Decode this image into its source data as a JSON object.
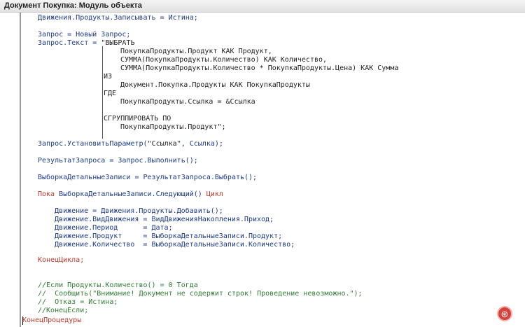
{
  "window": {
    "title": "Документ Покупка: Модуль объекта"
  },
  "code": {
    "l01": "Движения.Продукты.Записывать = Истина;",
    "l02": "Запрос = Новый Запрос;",
    "l03a": "Запрос.Текст = ",
    "l03b": "\"ВЫБРАТЬ",
    "l04": "ПокупкаПродукты.Продукт КАК Продукт,",
    "l05": "СУММА(ПокупкаПродукты.Количество) КАК Количество,",
    "l06": "СУММА(ПокупкаПродукты.Количество * ПокупкаПродукты.Цена) КАК Сумма",
    "l07": "ИЗ",
    "l08": "Документ.Покупка.Продукты КАК ПокупкаПродукты",
    "l09": "ГДЕ",
    "l10": "ПокупкаПродукты.Ссылка = &Ссылка",
    "l11": "СГРУППИРОВАТЬ ПО",
    "l12": "ПокупкаПродукты.Продукт\";",
    "l13a": "Запрос.УстановитьПараметр(",
    "l13b": "\"Ссылка\"",
    "l13c": ", Ссылка);",
    "l14": "РезультатЗапроса = Запрос.Выполнить();",
    "l15": "ВыборкаДетальныеЗаписи = РезультатЗапроса.Выбрать();",
    "l16a": "Пока ",
    "l16b": "ВыборкаДетальныеЗаписи.Следующий()",
    "l16c": " Цикл",
    "l17": "Движение = Движения.Продукты.Добавить();",
    "l18": "Движение.ВидДвижения = ВидДвиженияНакопления.Приход;",
    "l19": "Движение.Период      = Дата;",
    "l20": "Движение.Продукт     = ВыборкаДетальныеЗаписи.Продукт;",
    "l21": "Движение.Количество  = ВыборкаДетальныеЗаписи.Количество;",
    "l22": "КонецЦикла;",
    "l23": "//Если Продукты.Количество() = 0 Тогда",
    "l24": "//  Сообщить(\"Внимание! Документ не содержит строк! Проведение невозможно.\");",
    "l25": "//  Отказ = Истина;",
    "l26": "//КонецЕсли;",
    "l27": "КонецПроцедуры"
  },
  "help_button": {
    "icon": "help-lifebuoy-icon",
    "glyph": "⊛",
    "color": "#d9413b"
  }
}
